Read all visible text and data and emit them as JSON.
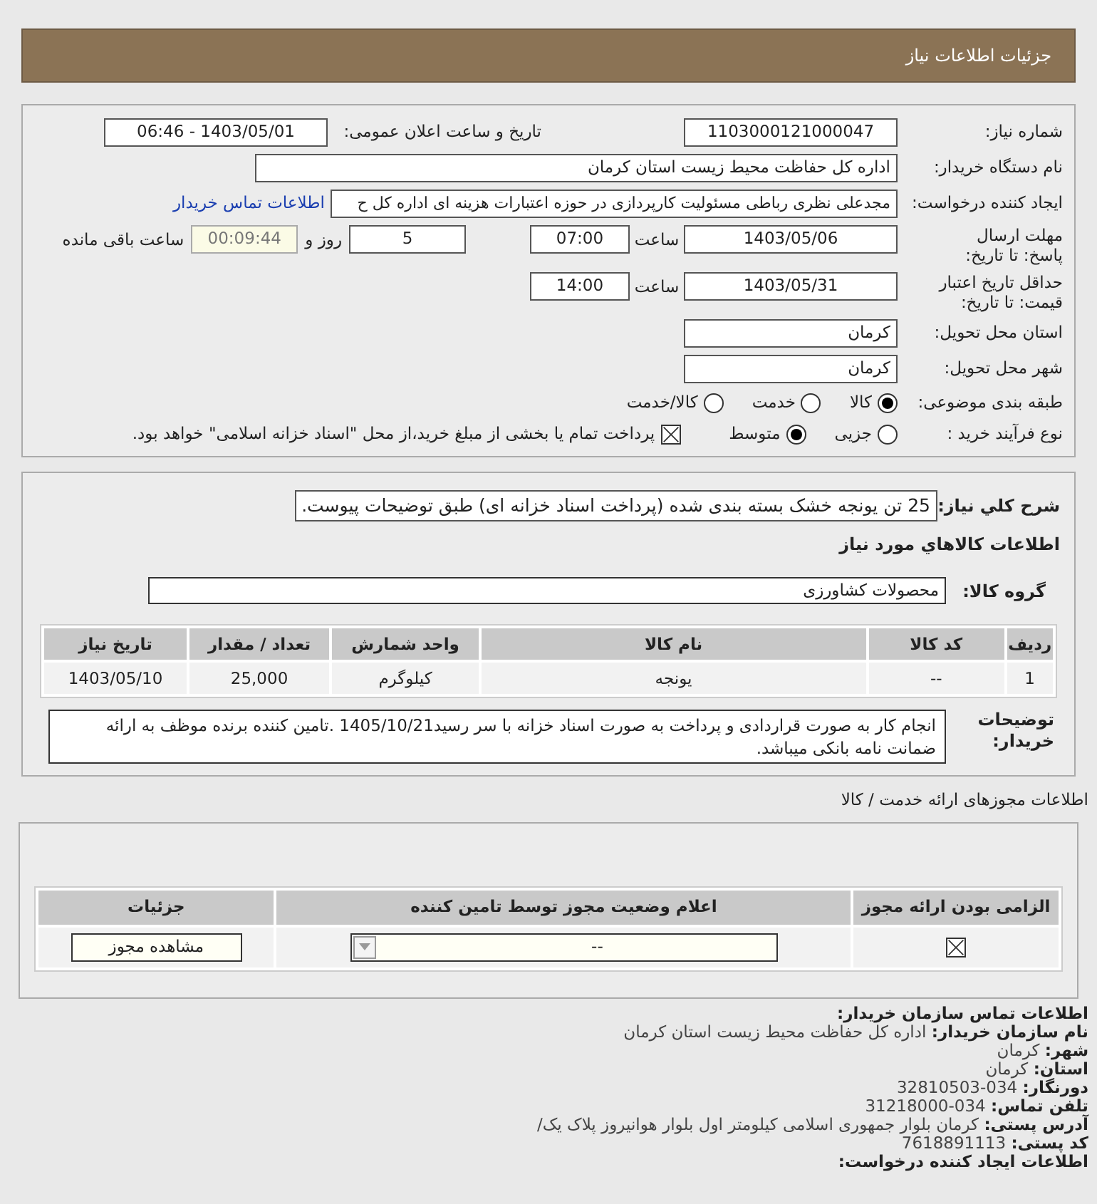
{
  "header": {
    "title": "جزئیات اطلاعات نیاز"
  },
  "need_number": {
    "label": "شماره نیاز:",
    "value": "1103000121000047"
  },
  "announce": {
    "label": "تاریخ و ساعت اعلان عمومی:",
    "value": "1403/05/01 - 06:46"
  },
  "buyer": {
    "label": "نام دستگاه خریدار:",
    "value": "اداره کل حفاظت محیط زیست استان کرمان"
  },
  "creator": {
    "label": "ایجاد کننده درخواست:",
    "value": "مجدعلی نظری رباطی مسئولیت کارپردازی در حوزه اعتبارات هزینه ای اداره کل ح",
    "link": "اطلاعات تماس خریدار"
  },
  "deadline": {
    "label": "مهلت ارسال پاسخ: تا تاریخ:",
    "date": "1403/05/06",
    "time_label": "ساعت",
    "time": "07:00",
    "days": "5",
    "days_label": "روز و",
    "remaining": "00:09:44",
    "remaining_label": "ساعت باقی مانده"
  },
  "validity": {
    "label": "حداقل تاریخ اعتبار قیمت: تا تاریخ:",
    "date": "1403/05/31",
    "time_label": "ساعت",
    "time": "14:00"
  },
  "province": {
    "label": "استان محل تحویل:",
    "value": "کرمان"
  },
  "city": {
    "label": "شهر محل تحویل:",
    "value": "کرمان"
  },
  "category": {
    "label": "طبقه بندی موضوعی:",
    "options": [
      {
        "label": "کالا",
        "selected": true
      },
      {
        "label": "خدمت",
        "selected": false
      },
      {
        "label": "کالا/خدمت",
        "selected": false
      }
    ]
  },
  "process": {
    "label": "نوع فرآیند خرید :",
    "options": [
      {
        "label": "جزیی",
        "selected": false
      },
      {
        "label": "متوسط",
        "selected": true
      }
    ],
    "payment": {
      "checked": true,
      "label": "پرداخت تمام یا بخشی از مبلغ خرید،از محل \"اسناد خزانه اسلامی\" خواهد بود."
    }
  },
  "summary": {
    "label": "شرح کلي نياز:",
    "value": "25 تن یونجه خشک بسته بندی شده (پرداخت اسناد خزانه ای) طبق توضیحات پیوست."
  },
  "goods_title": "اطلاعات کالاهاي مورد نياز",
  "group": {
    "label": "گروه کالا:",
    "value": "محصولات کشاورزی"
  },
  "goods_table": {
    "columns": [
      "ردیف",
      "کد کالا",
      "نام کالا",
      "واحد شمارش",
      "تعداد / مقدار",
      "تاریخ نیاز"
    ],
    "rows": [
      [
        "1",
        "--",
        "یونجه",
        "کیلوگرم",
        "25,000",
        "1403/05/10"
      ]
    ]
  },
  "buyer_notes": {
    "label": "توضیحات خریدار:",
    "value": "انجام کار به صورت قراردادی و پرداخت به صورت اسناد خزانه با سر رسید1405/10/21 .تامین کننده برنده موظف به ارائه ضمانت نامه بانکی میباشد."
  },
  "permits": {
    "title": "اطلاعات مجوزهای ارائه خدمت / کالا",
    "columns": [
      "الزامی بودن ارائه مجوز",
      "اعلام وضعیت مجوز توسط تامین کننده",
      "جزئیات"
    ],
    "rows": [
      {
        "required": true,
        "status": "--",
        "action": "مشاهده مجوز"
      }
    ]
  },
  "contact": {
    "title": "اطلاعات تماس سازمان خریدار:",
    "lines": [
      {
        "label": "نام سازمان خریدار:",
        "value": "اداره کل حفاظت محیط زیست استان کرمان"
      },
      {
        "label": "شهر:",
        "value": "کرمان"
      },
      {
        "label": "استان:",
        "value": "کرمان"
      },
      {
        "label": "دورنگار:",
        "value": "034-32810503"
      },
      {
        "label": "تلفن تماس:",
        "value": "034-31218000"
      },
      {
        "label": "آدرس پستی:",
        "value": "کرمان بلوار جمهوری اسلامی کیلومتر اول بلوار هوانیروز پلاک یک/"
      },
      {
        "label": "کد پستی:",
        "value": "7618891113"
      }
    ],
    "next_title": "اطلاعات ایجاد کننده درخواست:"
  }
}
